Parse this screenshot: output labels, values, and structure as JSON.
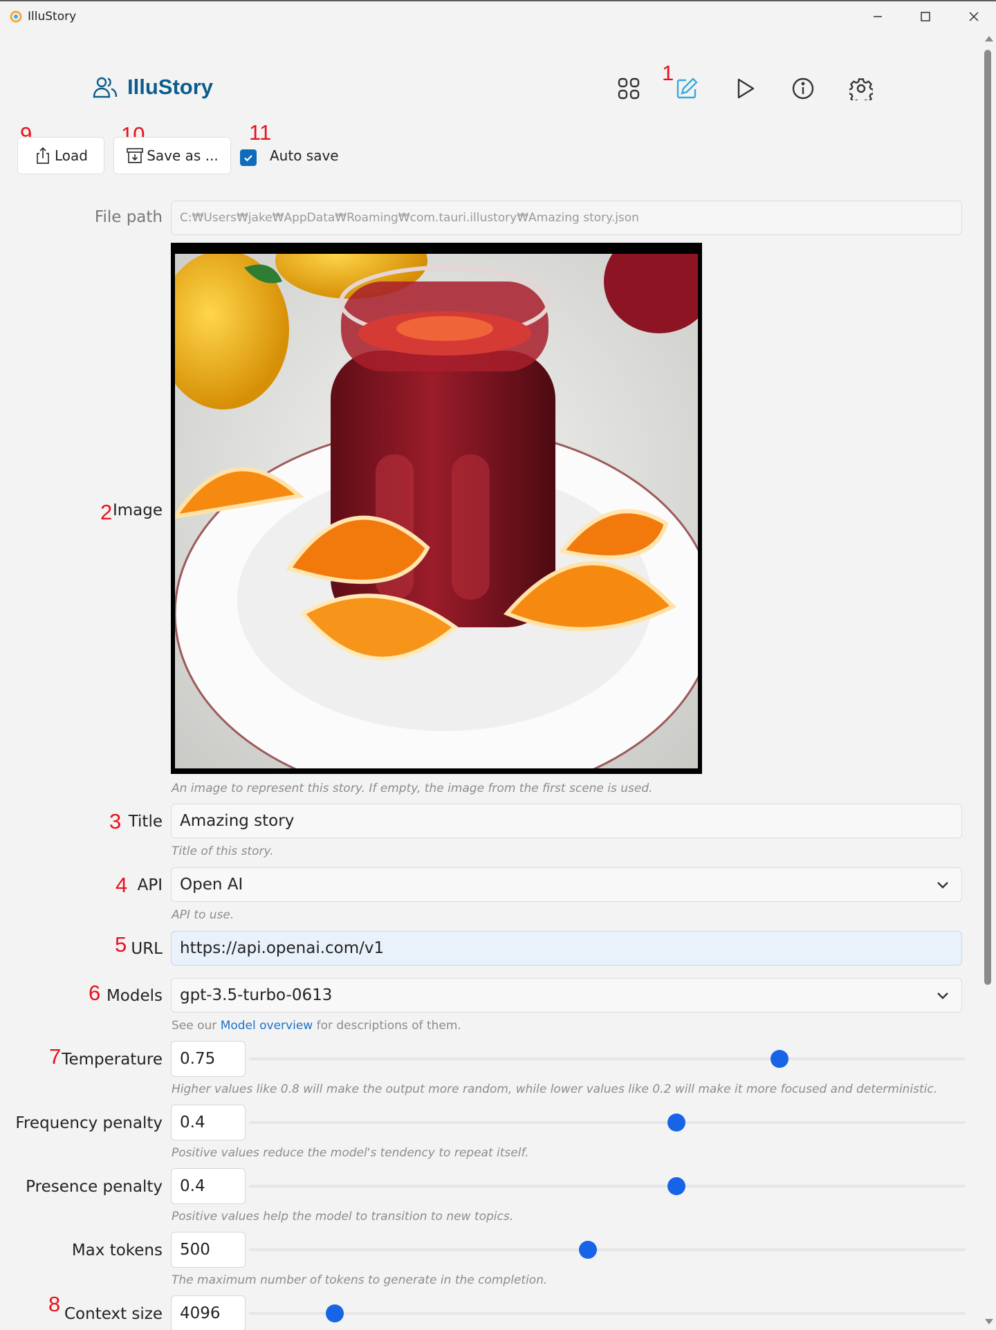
{
  "window": {
    "title": "IlluStory"
  },
  "header": {
    "app_name": "IlluStory",
    "nav": [
      {
        "icon": "grid-icon",
        "label": "Library"
      },
      {
        "icon": "edit-icon",
        "label": "Edit"
      },
      {
        "icon": "play-icon",
        "label": "Play"
      },
      {
        "icon": "info-icon",
        "label": "Info"
      },
      {
        "icon": "gear-icon",
        "label": "Settings"
      }
    ]
  },
  "annotations": [
    "1",
    "2",
    "3",
    "4",
    "5",
    "6",
    "7",
    "8",
    "9",
    "10",
    "11"
  ],
  "toolbar": {
    "load_label": "Load",
    "save_as_label": "Save as ...",
    "auto_save_label": "Auto save",
    "auto_save_checked": true
  },
  "form": {
    "file_path": {
      "label": "File path",
      "value": "C:₩Users₩jake₩AppData₩Roaming₩com.tauri.illustory₩Amazing story.json"
    },
    "image": {
      "label": "Image",
      "help": "An image to represent this story. If empty, the image from the first scene is used."
    },
    "title": {
      "label": "Title",
      "value": "Amazing story",
      "help": "Title of this story."
    },
    "api": {
      "label": "API",
      "value": "Open AI",
      "help": "API to use."
    },
    "url": {
      "label": "URL",
      "value": "https://api.openai.com/v1"
    },
    "models": {
      "label": "Models",
      "value": "gpt-3.5-turbo-0613",
      "help_prefix": "See our",
      "help_link": "Model overview",
      "help_suffix": "for descriptions of them."
    },
    "sliders": [
      {
        "label": "Temperature",
        "value": "0.75",
        "fraction": 0.74,
        "help": "Higher values like 0.8 will make the output more random, while lower values like 0.2 will make it more focused and deterministic."
      },
      {
        "label": "Frequency penalty",
        "value": "0.4",
        "fraction": 0.597,
        "help": "Positive values reduce the model's tendency to repeat itself."
      },
      {
        "label": "Presence penalty",
        "value": "0.4",
        "fraction": 0.597,
        "help": "Positive values help the model to transition to new topics."
      },
      {
        "label": "Max tokens",
        "value": "500",
        "fraction": 0.473,
        "help": "The maximum number of tokens to generate in the completion."
      },
      {
        "label": "Context size",
        "value": "4096",
        "fraction": 0.12,
        "help": ""
      }
    ]
  },
  "colors": {
    "accent": "#0f6cbd",
    "brand": "#0d5c8c",
    "slider_thumb": "#1864e6",
    "annotation": "#e8101c"
  }
}
